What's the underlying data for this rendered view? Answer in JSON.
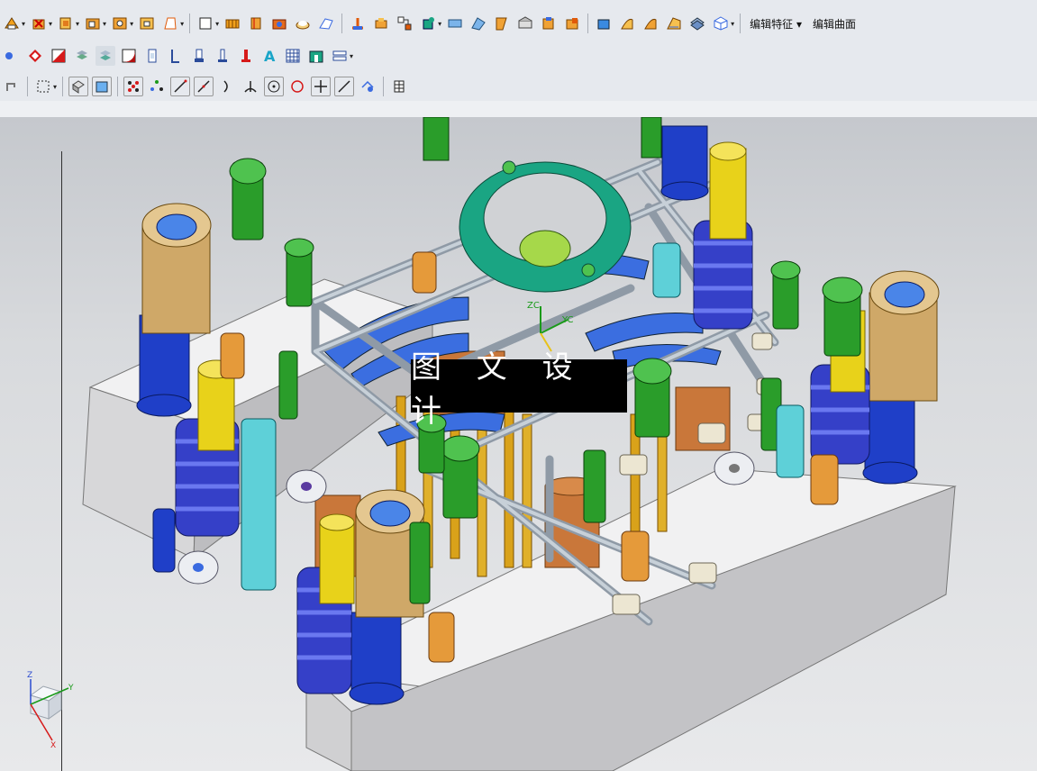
{
  "toolbar": {
    "row1_menu_labels": [
      "编辑特征 ▾",
      "编辑曲面"
    ],
    "row1_icons": [
      "sketch-icon",
      "extrude-icon",
      "revolve-icon",
      "hole-icon",
      "boss-icon",
      "pocket-icon",
      "pad-icon",
      "rectangle-icon",
      "sew-icon",
      "unite-icon",
      "block-icon",
      "cylinder-icon",
      "cone-icon",
      "sphere-icon",
      "trim-body-icon",
      "split-body-icon",
      "offset-face-icon",
      "thicken-icon",
      "shell-icon",
      "draft-icon",
      "blend-icon",
      "chamfer-icon",
      "box-icon",
      "move-face-icon",
      "delete-face-icon",
      "replace-face-icon",
      "mirror-icon",
      "pattern-icon"
    ],
    "row2_icons": [
      "select-filter-icon",
      "snap-icon",
      "face-color-icon",
      "layer-icon",
      "layer-settings-icon",
      "section-icon",
      "slot-icon",
      "ejector-icon",
      "lifter-icon",
      "gate-icon",
      "runner-icon",
      "cooling-icon",
      "electrode-icon",
      "mesh-icon",
      "parting-icon",
      "bom-icon"
    ],
    "row3_icons": [
      "undo-icon",
      "select-box-icon",
      "shaded-icon",
      "wireframe-icon",
      "points-icon",
      "snap-point-icon",
      "line-icon",
      "arc-icon",
      "curve-icon",
      "fillet-icon",
      "circle-icon",
      "point-on-icon",
      "cross-icon",
      "angle-icon",
      "measure-icon",
      "grid-icon"
    ]
  },
  "viewport": {
    "watermark": "图 文 设 计",
    "triad_labels": {
      "z": "Z",
      "y": "Y",
      "x": "X"
    },
    "center_axes_labels": {
      "yc": "YC",
      "zc": "ZC"
    },
    "colors": {
      "base_plate": "#e3e3e5",
      "blue_part": "#1f3fc8",
      "yellow_part": "#e8d21a",
      "green_part": "#2a9d2a",
      "teal_ring": "#1aa583",
      "copper": "#c9773a",
      "tan_sleeve": "#cfa868",
      "light_blue": "#5ed0d8",
      "silver": "#b9c4cc",
      "gold_pin": "#d9a21a"
    }
  }
}
